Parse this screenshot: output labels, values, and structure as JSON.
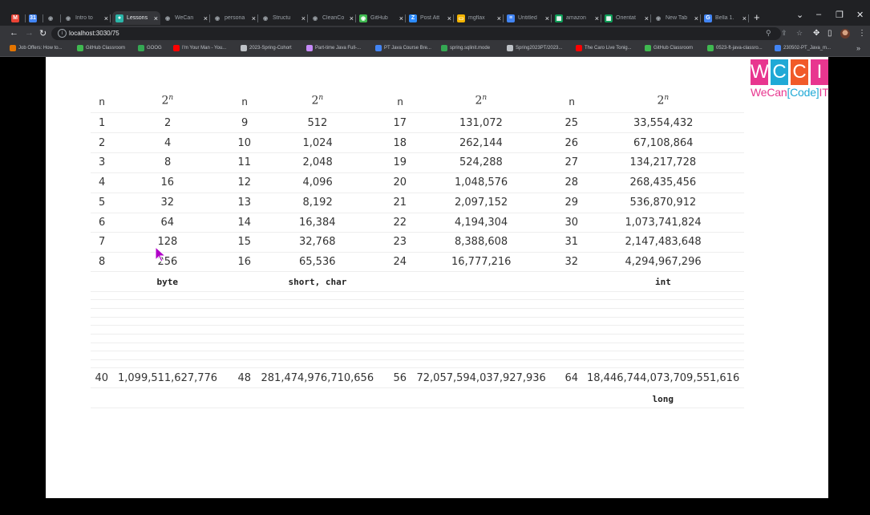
{
  "tabs": [
    {
      "label": "",
      "icon": "gmail-icon",
      "color": "#ea4335",
      "glyph": "M"
    },
    {
      "label": "",
      "icon": "calendar-icon",
      "color": "#4285f4",
      "glyph": "31"
    },
    {
      "label": "",
      "icon": "github-icon",
      "color": "#9aa0a6",
      "glyph": "◉"
    },
    {
      "label": "Intro to",
      "icon": "github-icon",
      "color": "#9aa0a6",
      "glyph": "◉"
    },
    {
      "label": "Lessons",
      "icon": "globe-icon",
      "color": "#2bb5a8",
      "glyph": "●",
      "active": true
    },
    {
      "label": "WeCan",
      "icon": "github-icon",
      "color": "#9aa0a6",
      "glyph": "◉"
    },
    {
      "label": "persona",
      "icon": "github-icon",
      "color": "#9aa0a6",
      "glyph": "◉"
    },
    {
      "label": "Structu",
      "icon": "github-icon",
      "color": "#9aa0a6",
      "glyph": "◉"
    },
    {
      "label": "CleanCo",
      "icon": "github-icon",
      "color": "#9aa0a6",
      "glyph": "◉"
    },
    {
      "label": "GitHub",
      "icon": "github-classroom-icon",
      "color": "#3fb950",
      "glyph": "◉"
    },
    {
      "label": "Post Att",
      "icon": "zoom-icon",
      "color": "#2d8cff",
      "glyph": "Z"
    },
    {
      "label": "mgflax",
      "icon": "slides-icon",
      "color": "#f4b400",
      "glyph": "▭"
    },
    {
      "label": "Untitled",
      "icon": "docs-icon",
      "color": "#4285f4",
      "glyph": "≡"
    },
    {
      "label": "amazon",
      "icon": "sheets-icon",
      "color": "#0f9d58",
      "glyph": "▦"
    },
    {
      "label": "Orientat",
      "icon": "sheets-icon",
      "color": "#0f9d58",
      "glyph": "▦"
    },
    {
      "label": "New Tab",
      "icon": "chrome-icon",
      "color": "#9aa0a6",
      "glyph": "◉"
    },
    {
      "label": "Bella 1.",
      "icon": "google-icon",
      "color": "#4285f4",
      "glyph": "G"
    }
  ],
  "url": "localhost:3030/75",
  "bookmarks": [
    {
      "label": "Job Offers: How to...",
      "color": "#e37400"
    },
    {
      "label": "GitHub Classroom",
      "color": "#3fb950"
    },
    {
      "label": "GOOG",
      "color": "#34a853"
    },
    {
      "label": "I'm Your Man - You...",
      "color": "#ff0000"
    },
    {
      "label": "2023-Spring-Cohort",
      "color": "#bdc1c6"
    },
    {
      "label": "Part-time Java Full-...",
      "color": "#c58af9"
    },
    {
      "label": "PT Java Course Bre...",
      "color": "#4285f4"
    },
    {
      "label": "spring.sqlinit.mode",
      "color": "#34a853"
    },
    {
      "label": "Spring2023PT/2023...",
      "color": "#bdc1c6"
    },
    {
      "label": "The Caro Live Tonig...",
      "color": "#ff0000"
    },
    {
      "label": "GitHub Classroom",
      "color": "#3fb950"
    },
    {
      "label": "0523-ft-java-classro...",
      "color": "#3fb950"
    },
    {
      "label": "230502-PT_Java_m...",
      "color": "#4285f4"
    }
  ],
  "logo": {
    "letters": [
      "W",
      "C",
      "C",
      "I"
    ],
    "colors": [
      "#e8368f",
      "#1fa9d6",
      "#f15a29",
      "#e8368f"
    ],
    "tagline_a": "WeCan",
    "tagline_b": "[Code]",
    "tagline_c": "IT"
  },
  "table": {
    "header_n": "n",
    "header_pow_base": "2",
    "header_pow_exp": "n",
    "columns": [
      {
        "rows": [
          [
            "1",
            "2"
          ],
          [
            "2",
            "4"
          ],
          [
            "3",
            "8"
          ],
          [
            "4",
            "16"
          ],
          [
            "5",
            "32"
          ],
          [
            "6",
            "64"
          ],
          [
            "7",
            "128"
          ],
          [
            "8",
            "256"
          ]
        ],
        "type": "byte",
        "big": [
          "40",
          "1,099,511,627,776"
        ]
      },
      {
        "rows": [
          [
            "9",
            "512"
          ],
          [
            "10",
            "1,024"
          ],
          [
            "11",
            "2,048"
          ],
          [
            "12",
            "4,096"
          ],
          [
            "13",
            "8,192"
          ],
          [
            "14",
            "16,384"
          ],
          [
            "15",
            "32,768"
          ],
          [
            "16",
            "65,536"
          ]
        ],
        "type": "short, char",
        "big": [
          "48",
          "281,474,976,710,656"
        ]
      },
      {
        "rows": [
          [
            "17",
            "131,072"
          ],
          [
            "18",
            "262,144"
          ],
          [
            "19",
            "524,288"
          ],
          [
            "20",
            "1,048,576"
          ],
          [
            "21",
            "2,097,152"
          ],
          [
            "22",
            "4,194,304"
          ],
          [
            "23",
            "8,388,608"
          ],
          [
            "24",
            "16,777,216"
          ]
        ],
        "type": "",
        "big": [
          "56",
          "72,057,594,037,927,936"
        ]
      },
      {
        "rows": [
          [
            "25",
            "33,554,432"
          ],
          [
            "26",
            "67,108,864"
          ],
          [
            "27",
            "134,217,728"
          ],
          [
            "28",
            "268,435,456"
          ],
          [
            "29",
            "536,870,912"
          ],
          [
            "30",
            "1,073,741,824"
          ],
          [
            "31",
            "2,147,483,648"
          ],
          [
            "32",
            "4,294,967,296"
          ]
        ],
        "type": "int",
        "big": [
          "64",
          "18,446,744,073,709,551,616"
        ]
      }
    ],
    "bottom_type": "long"
  }
}
